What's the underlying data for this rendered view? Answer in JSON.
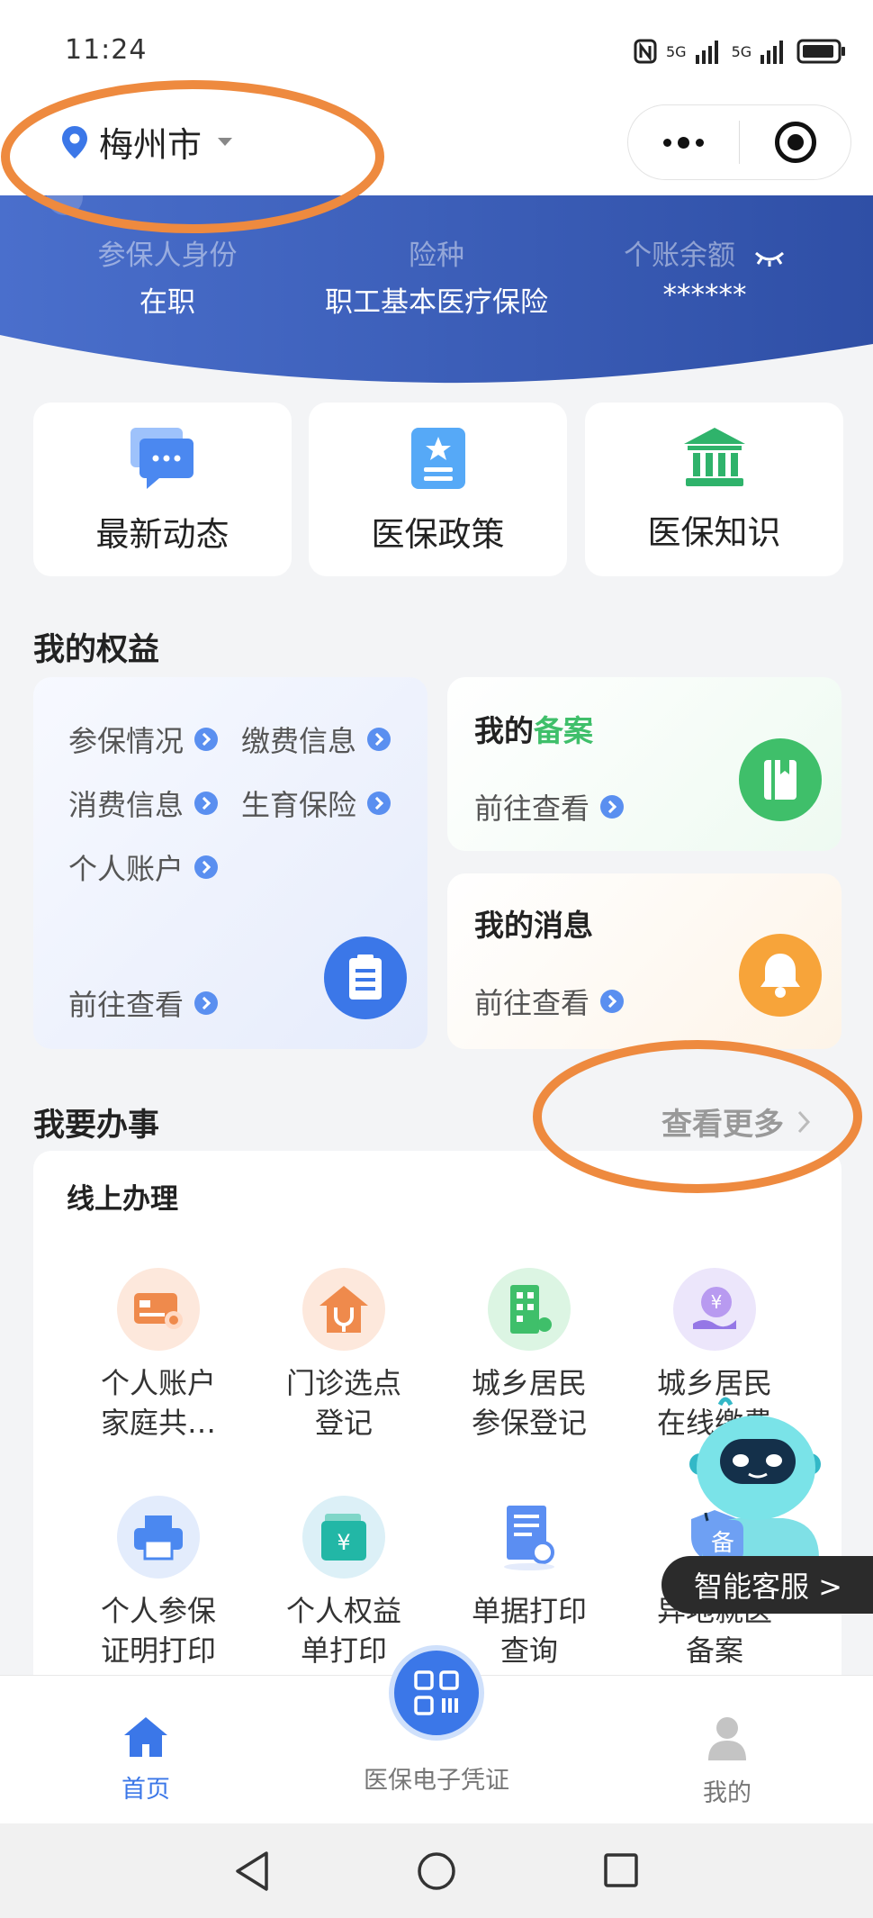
{
  "status_bar": {
    "time": "11:24",
    "signal_1": "5G",
    "signal_2": "5G"
  },
  "header": {
    "city": "梅州市"
  },
  "banner": {
    "fields": [
      {
        "label": "参保人身份",
        "value": "在职"
      },
      {
        "label": "险种",
        "value": "职工基本医疗保险"
      },
      {
        "label": "个账余额",
        "value": "******"
      }
    ]
  },
  "quick_links": [
    {
      "label": "最新动态",
      "icon": "chat-bubble-icon"
    },
    {
      "label": "医保政策",
      "icon": "document-star-icon"
    },
    {
      "label": "医保知识",
      "icon": "bank-building-icon"
    }
  ],
  "rights": {
    "title": "我的权益",
    "links": [
      "参保情况",
      "缴费信息",
      "消费信息",
      "生育保险",
      "个人账户"
    ],
    "go_label": "前往查看",
    "filing": {
      "title_prefix": "我的",
      "title_highlight": "备案",
      "go_label": "前往查看"
    },
    "messages": {
      "title": "我的消息",
      "go_label": "前往查看"
    }
  },
  "services": {
    "title": "我要办事",
    "more_label": "查看更多",
    "card_title": "线上办理",
    "items": [
      {
        "line1": "个人账户",
        "line2": "家庭共…",
        "icon": "card-icon"
      },
      {
        "line1": "门诊选点",
        "line2": "登记",
        "icon": "clinic-house-icon"
      },
      {
        "line1": "城乡居民",
        "line2": "参保登记",
        "icon": "building-icon"
      },
      {
        "line1": "城乡居民",
        "line2": "在线缴费",
        "icon": "yuan-hand-icon"
      },
      {
        "line1": "个人参保",
        "line2": "证明打印",
        "icon": "printer-icon"
      },
      {
        "line1": "个人权益",
        "line2": "单打印",
        "icon": "wallet-icon"
      },
      {
        "line1": "单据打印",
        "line2": "查询",
        "icon": "receipt-search-icon"
      },
      {
        "line1": "异地就医",
        "line2": "备案",
        "icon": "shield-icon"
      }
    ]
  },
  "assistant": {
    "label": "智能客服 >",
    "badge": "备"
  },
  "tab_bar": {
    "tabs": [
      {
        "label": "首页",
        "active": true
      },
      {
        "label": "医保电子凭证",
        "active": false
      },
      {
        "label": "我的",
        "active": false
      }
    ]
  },
  "colors": {
    "primary": "#3b77e8",
    "banner": "#3d5fb9",
    "highlight_green": "#3fbf6a",
    "annotation_orange": "#ee8a3f"
  }
}
